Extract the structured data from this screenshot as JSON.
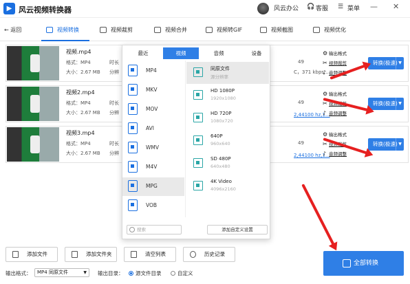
{
  "app": {
    "title": "风云视频转换器",
    "account": "风云办公",
    "service": "客服",
    "menu": "菜单"
  },
  "nav": {
    "back": "返回",
    "tabs": [
      "视频转换",
      "视频裁剪",
      "视频合并",
      "视频转GIF",
      "视频截图",
      "视频优化"
    ]
  },
  "files": [
    {
      "name": "视频.mp4",
      "format": "格式：MP4",
      "size": "大小：2.67 MB",
      "dur": "时长",
      "res": "分辨",
      "info": "C，371 kbps,...",
      "num": "49"
    },
    {
      "name": "视频2.mp4",
      "format": "格式：MP4",
      "size": "大小：2.67 MB",
      "dur": "时长",
      "res": "分辨",
      "info": "2,44100 hz,1...",
      "num": "49"
    },
    {
      "name": "视频3.mp4",
      "format": "格式：MP4",
      "size": "大小：2.67 MB",
      "dur": "时长",
      "res": "分辨",
      "info": "2,44100 hz,1...",
      "num": "49"
    }
  ],
  "row_options": [
    "输出格式",
    "视频裁剪",
    "音频调整"
  ],
  "convert_label": "转换(极速)",
  "popup": {
    "tabs": [
      "最近",
      "视频",
      "音频",
      "设备"
    ],
    "formats": [
      "MP4",
      "MKV",
      "MOV",
      "AVI",
      "WMV",
      "M4V",
      "MPG",
      "VOB"
    ],
    "presets": [
      {
        "name": "同原文件",
        "spec": "源分辨率"
      },
      {
        "name": "HD 1080P",
        "spec": "1920x1080"
      },
      {
        "name": "HD 720P",
        "spec": "1080x720"
      },
      {
        "name": "640P",
        "spec": "960x640"
      },
      {
        "name": "SD 480P",
        "spec": "640x480"
      },
      {
        "name": "4K Video",
        "spec": "4096x2160"
      }
    ],
    "search_placeholder": "搜索",
    "add_custom": "添加自定义设置"
  },
  "bottom": {
    "add_file": "添加文件",
    "add_folder": "添加文件夹",
    "clear": "清空列表",
    "history": "历史记录",
    "out_format_label": "输出格式：",
    "out_format_value": "MP4 同原文件",
    "out_dir_label": "输出目录：",
    "dir_source": "源文件目录",
    "dir_custom": "自定义",
    "convert_all": "全部转换"
  },
  "colors": {
    "accent": "#2f7fe6",
    "arrow": "#e62020"
  }
}
